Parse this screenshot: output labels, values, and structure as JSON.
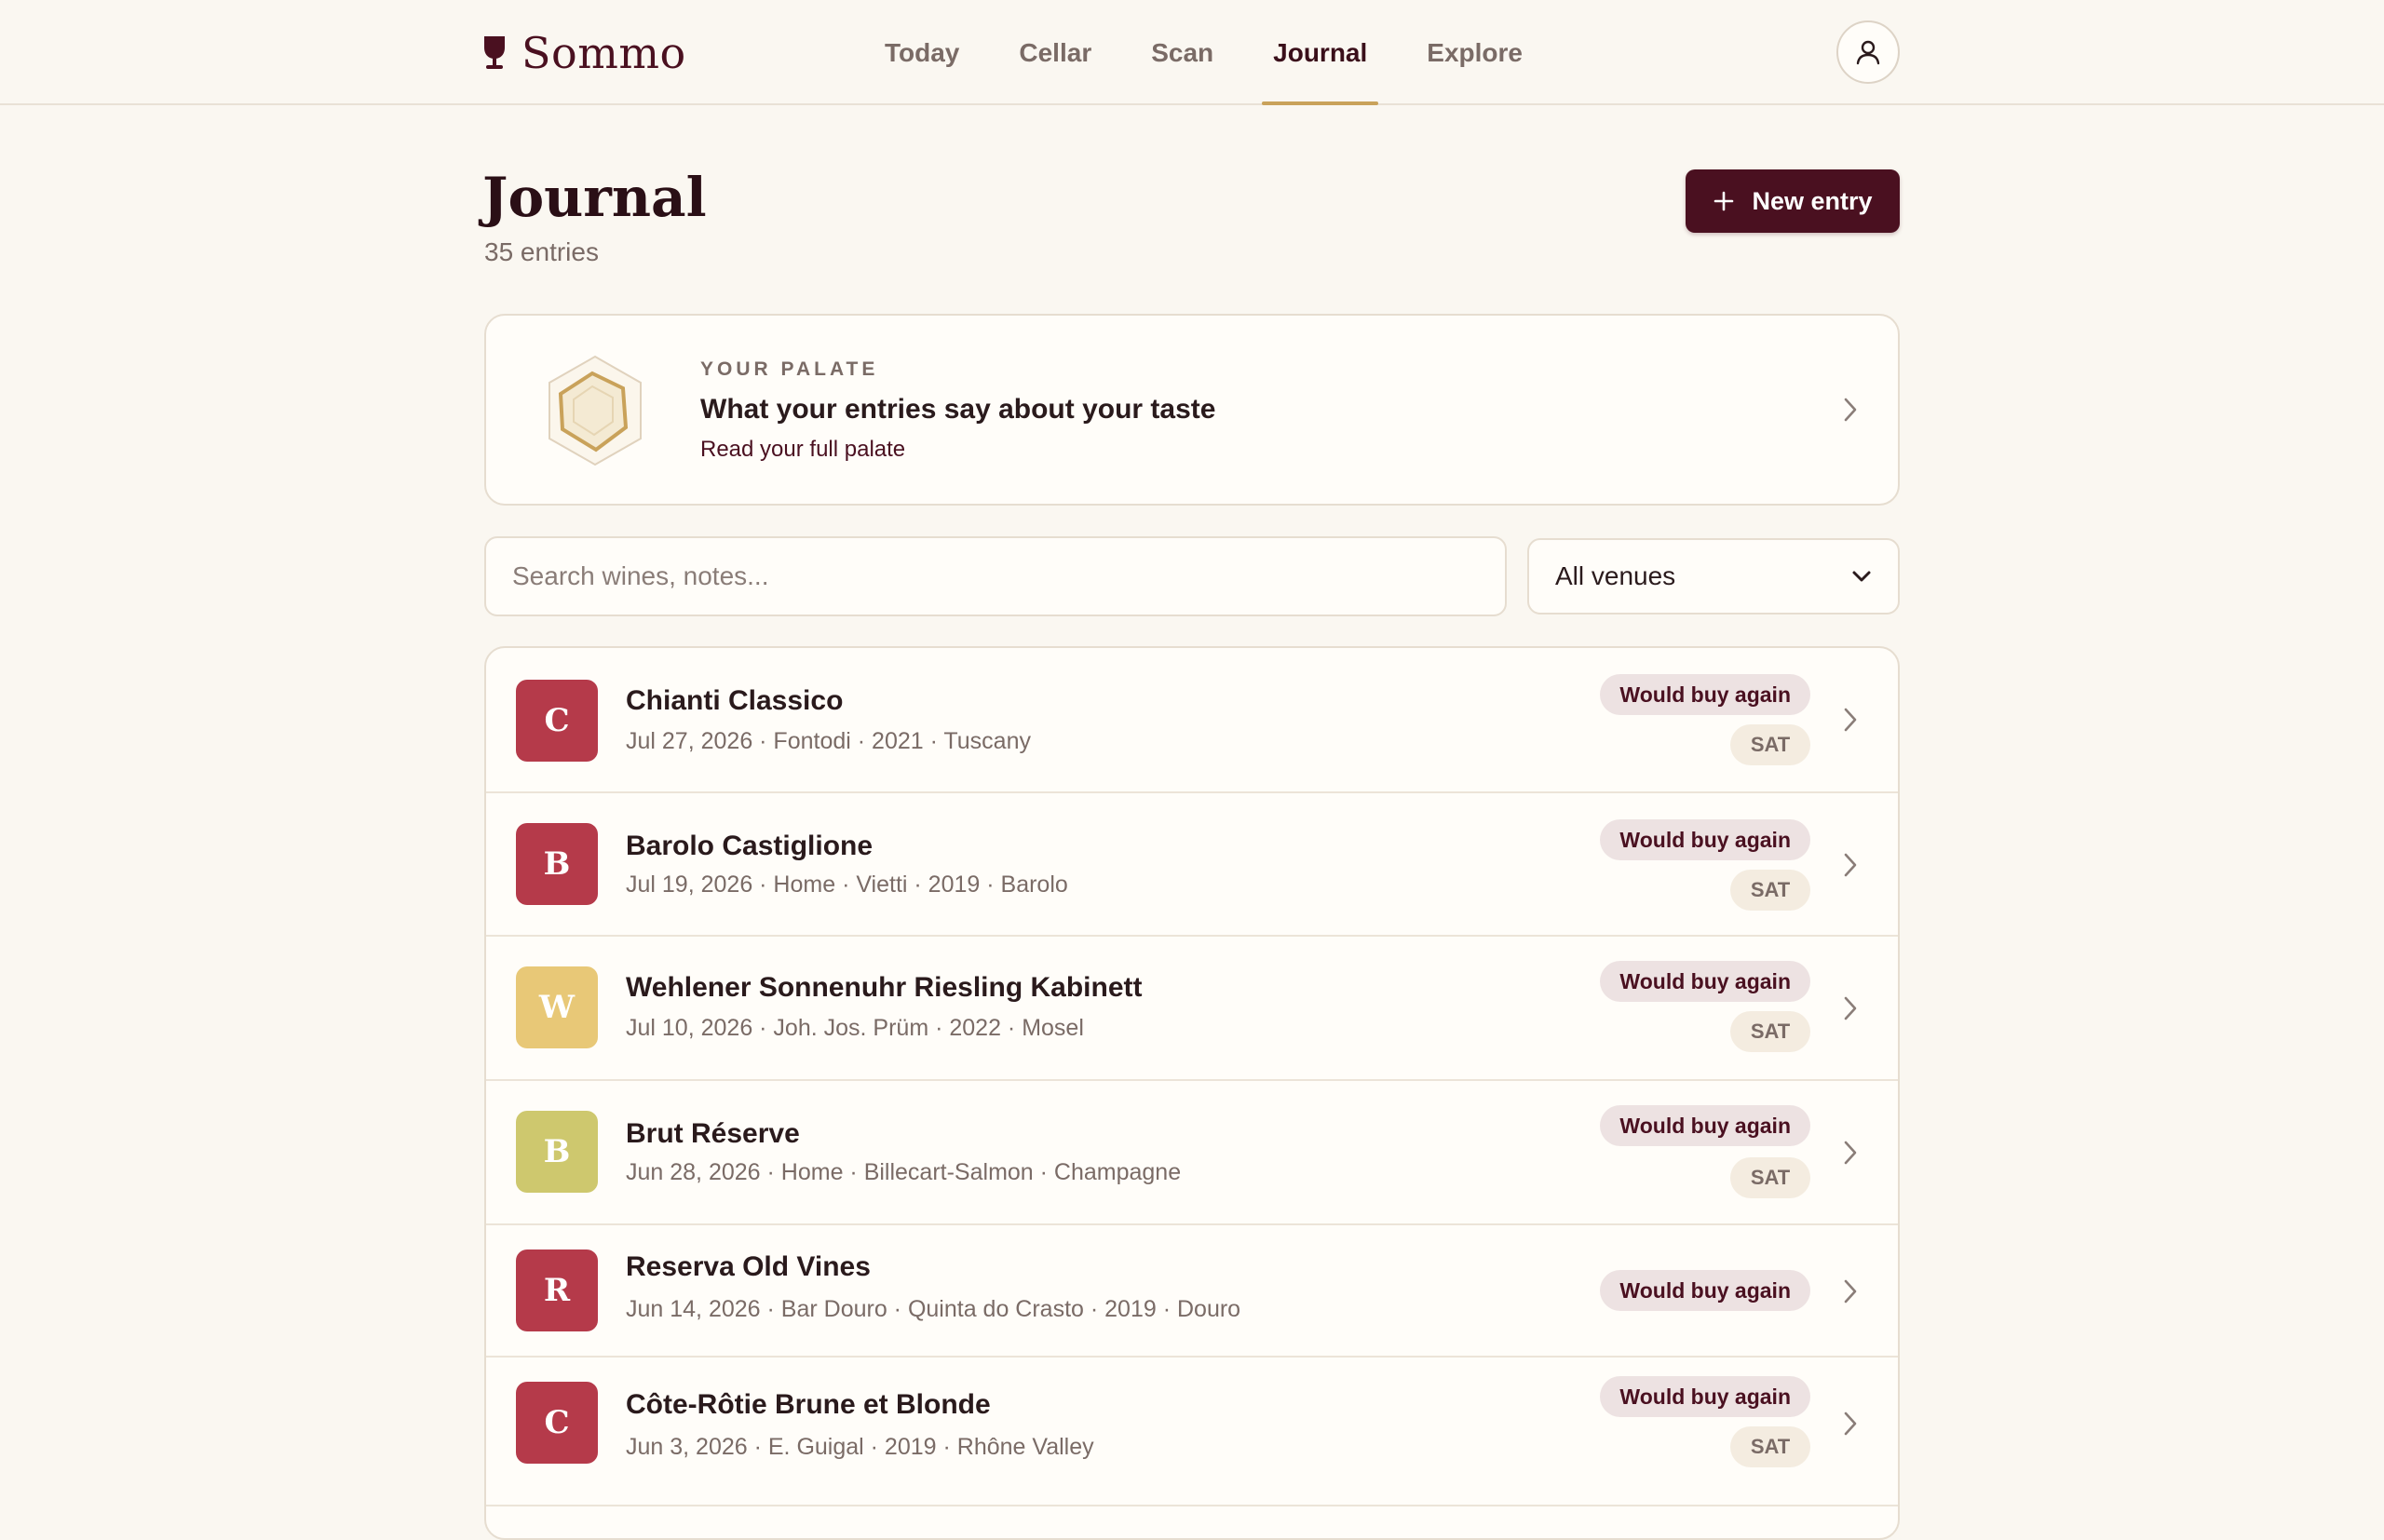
{
  "brand": {
    "name": "Sommo",
    "icon": "wine-glass-icon"
  },
  "nav": {
    "items": [
      {
        "label": "Today",
        "active": false
      },
      {
        "label": "Cellar",
        "active": false
      },
      {
        "label": "Scan",
        "active": false
      },
      {
        "label": "Journal",
        "active": true
      },
      {
        "label": "Explore",
        "active": false
      }
    ],
    "avatar_icon": "user-icon"
  },
  "header": {
    "title": "Journal",
    "subtitle": "35 entries",
    "new_entry_label": "New entry",
    "new_entry_icon": "plus-icon"
  },
  "palate": {
    "eyebrow": "YOUR PALATE",
    "title": "What your entries say about your taste",
    "link": "Read your full palate",
    "icon": "palate-hexagon-icon"
  },
  "filters": {
    "search_placeholder": "Search wines, notes...",
    "venue_selected": "All venues"
  },
  "colors": {
    "brand": "#4a1020",
    "accent": "#c9a25a",
    "red_wine": "#b53a4a",
    "white_wine": "#e8c877",
    "sparkling_wine": "#cec86e"
  },
  "entries": [
    {
      "letter": "C",
      "name": "Chianti Classico",
      "meta": "Jul 27, 2026 · Fontodi · 2021 · Tuscany",
      "tag": "Would buy again",
      "day": "SAT",
      "color": "#b53a4a"
    },
    {
      "letter": "B",
      "name": "Barolo Castiglione",
      "meta": "Jul 19, 2026 · Home · Vietti · 2019 · Barolo",
      "tag": "Would buy again",
      "day": "SAT",
      "color": "#b53a4a"
    },
    {
      "letter": "W",
      "name": "Wehlener Sonnenuhr Riesling Kabinett",
      "meta": "Jul 10, 2026 · Joh. Jos. Prüm · 2022 · Mosel",
      "tag": "Would buy again",
      "day": "SAT",
      "color": "#e8c877"
    },
    {
      "letter": "B",
      "name": "Brut Réserve",
      "meta": "Jun 28, 2026 · Home · Billecart-Salmon · Champagne",
      "tag": "Would buy again",
      "day": "SAT",
      "color": "#cec86e"
    },
    {
      "letter": "R",
      "name": "Reserva Old Vines",
      "meta": "Jun 14, 2026 · Bar Douro · Quinta do Crasto · 2019 · Douro",
      "tag": "Would buy again",
      "day": "",
      "color": "#b53a4a"
    },
    {
      "letter": "C",
      "name": "Côte-Rôtie Brune et Blonde",
      "meta": "Jun 3, 2026 · E. Guigal · 2019 · Rhône Valley",
      "tag": "Would buy again",
      "day": "SAT",
      "color": "#b53a4a"
    }
  ]
}
